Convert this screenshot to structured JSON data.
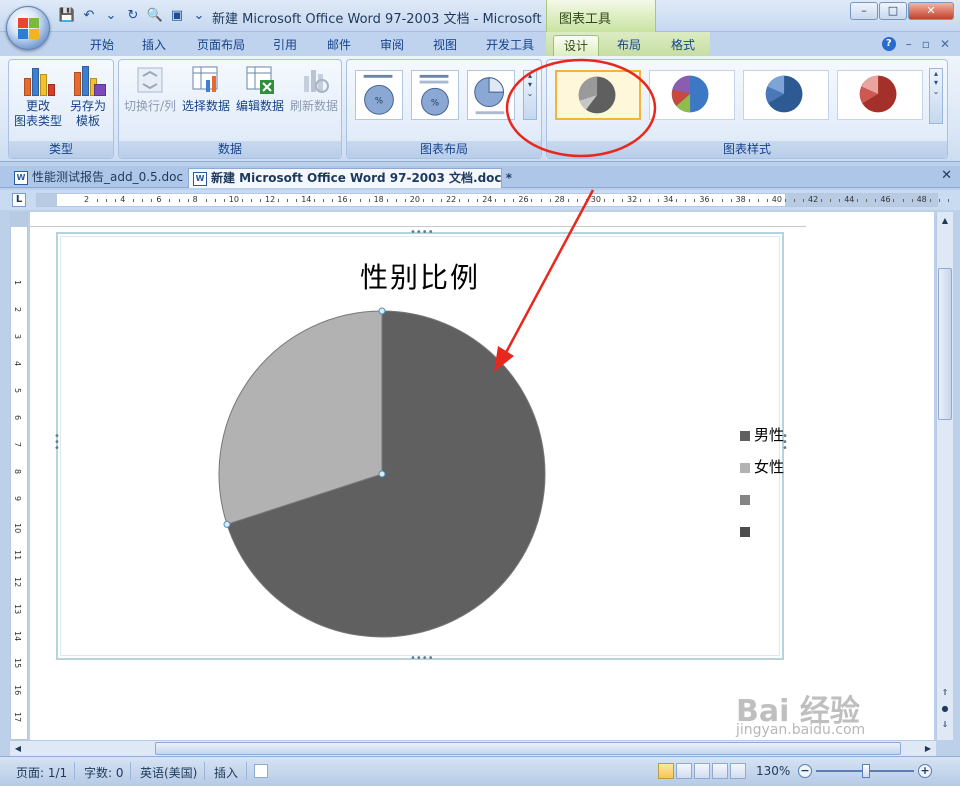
{
  "window": {
    "title": "新建 Microsoft Office Word 97-2003 文档 - Microsoft ...",
    "context_tool": "图表工具",
    "controls": {
      "minimize": "–",
      "maximize": "□",
      "close": "✕"
    }
  },
  "qat": {
    "save": "💾",
    "undo": "↶",
    "undo_more": "⌄",
    "redo": "↻",
    "preview": "🔍",
    "view": "▣",
    "more": "⌄"
  },
  "tabs": [
    {
      "label": "开始"
    },
    {
      "label": "插入"
    },
    {
      "label": "页面布局"
    },
    {
      "label": "引用"
    },
    {
      "label": "邮件"
    },
    {
      "label": "审阅"
    },
    {
      "label": "视图"
    },
    {
      "label": "开发工具"
    },
    {
      "label": "设计"
    },
    {
      "label": "布局"
    },
    {
      "label": "格式"
    }
  ],
  "tabs_right": {
    "help": "?",
    "minimize": "–",
    "restore": "▫",
    "close": "✕"
  },
  "ribbon": {
    "type_group": {
      "label": "类型",
      "change_type": [
        "更改",
        "图表类型"
      ],
      "save_template": [
        "另存为",
        "模板"
      ]
    },
    "data_group": {
      "label": "数据",
      "switch_row_col": "切换行/列",
      "select_data": "选择数据",
      "edit_data": "编辑数据",
      "refresh_data": "刷新数据"
    },
    "layout_group": {
      "label": "图表布局"
    },
    "style_group": {
      "label": "图表样式"
    }
  },
  "doc_tabs": [
    {
      "label": "性能测试报告_add_0.5.doc"
    },
    {
      "label": "新建 Microsoft Office Word 97-2003 文档.doc *"
    }
  ],
  "doc_close": "✕",
  "ruler": {
    "tab_marker": "L",
    "numbers": [
      "2",
      "4",
      "6",
      "8",
      "10",
      "12",
      "14",
      "16",
      "18",
      "20",
      "22",
      "24",
      "26",
      "28",
      "30",
      "32",
      "34",
      "36",
      "38",
      "40",
      "42",
      "44",
      "46",
      "48"
    ]
  },
  "chart_data": {
    "type": "pie",
    "title": "性别比例",
    "categories": [
      "男性",
      "女性",
      "",
      ""
    ],
    "values": [
      70,
      30
    ],
    "colors": [
      "#606060",
      "#b2b2b2",
      "#858585",
      "#4d4d4d"
    ],
    "legend": "right"
  },
  "status": {
    "page": "页面: 1/1",
    "words": "字数: 0",
    "language": "英语(美国)",
    "mode": "插入",
    "zoom": "130%"
  },
  "watermark": {
    "brand": "Bai 经验",
    "url": "jingyan.baidu.com"
  },
  "colors": {
    "annotation": "#e8281e",
    "accent": "#15428b"
  }
}
